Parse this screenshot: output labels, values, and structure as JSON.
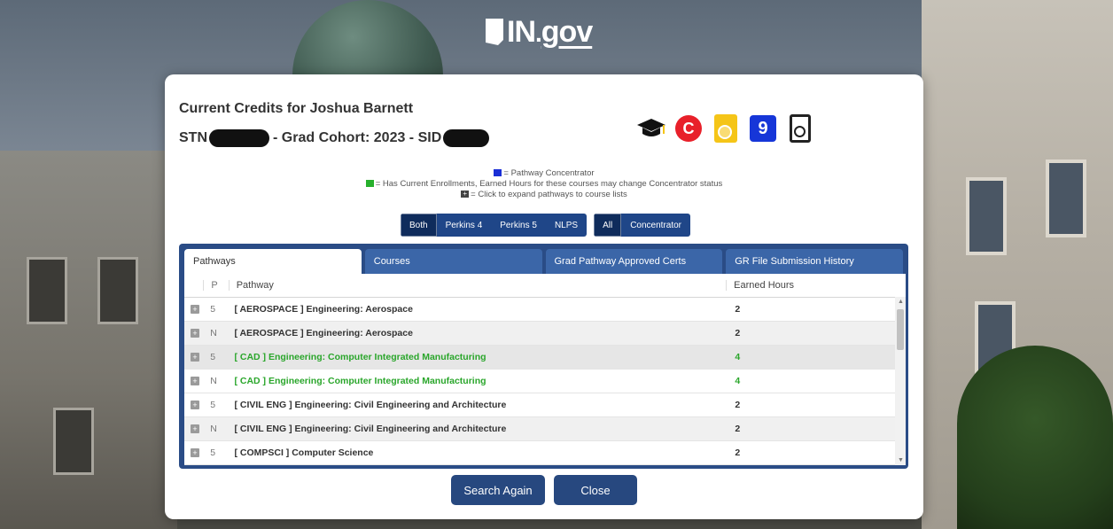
{
  "logo": {
    "state": "IN",
    "gov": "gov"
  },
  "header": {
    "title": "Current Credits for Joshua Barnett",
    "stn_label": "STN",
    "cohort": "- Grad Cohort: 2023 - SID"
  },
  "icons": [
    "graduation-cap-icon",
    "c-badge-icon",
    "certificate-icon",
    "nine-badge-icon",
    "certificate-outline-icon"
  ],
  "legend": {
    "blue": "= Pathway Concentrator",
    "green": "= Has Current Enrollments, Earned Hours for these courses may change Concentrator status",
    "plus": "= Click to expand pathways to course lists"
  },
  "filters": {
    "perkins": [
      "Both",
      "Perkins 4",
      "Perkins 5",
      "NLPS"
    ],
    "type": [
      "All",
      "Concentrator"
    ]
  },
  "tabs": [
    "Pathways",
    "Courses",
    "Grad Pathway Approved Certs",
    "GR File Submission History"
  ],
  "table": {
    "headers": {
      "p": "P",
      "pathway": "Pathway",
      "hours": "Earned Hours"
    },
    "rows": [
      {
        "p": "5",
        "pathway": "[ AEROSPACE ] Engineering: Aerospace",
        "hours": "2"
      },
      {
        "p": "N",
        "pathway": "[ AEROSPACE ] Engineering: Aerospace",
        "hours": "2"
      },
      {
        "p": "5",
        "pathway": "[ CAD ] Engineering: Computer Integrated Manufacturing",
        "hours": "4"
      },
      {
        "p": "N",
        "pathway": "[ CAD ] Engineering: Computer Integrated Manufacturing",
        "hours": "4"
      },
      {
        "p": "5",
        "pathway": "[ CIVIL ENG ] Engineering: Civil Engineering and Architecture",
        "hours": "2"
      },
      {
        "p": "N",
        "pathway": "[ CIVIL ENG ] Engineering: Civil Engineering and Architecture",
        "hours": "2"
      },
      {
        "p": "5",
        "pathway": "[ COMPSCI ] Computer Science",
        "hours": "2"
      }
    ]
  },
  "actions": {
    "search_again": "Search Again",
    "close": "Close"
  },
  "colors": {
    "accent": "#27487f",
    "green": "#2aa62b",
    "blue": "#1a2fd6"
  }
}
